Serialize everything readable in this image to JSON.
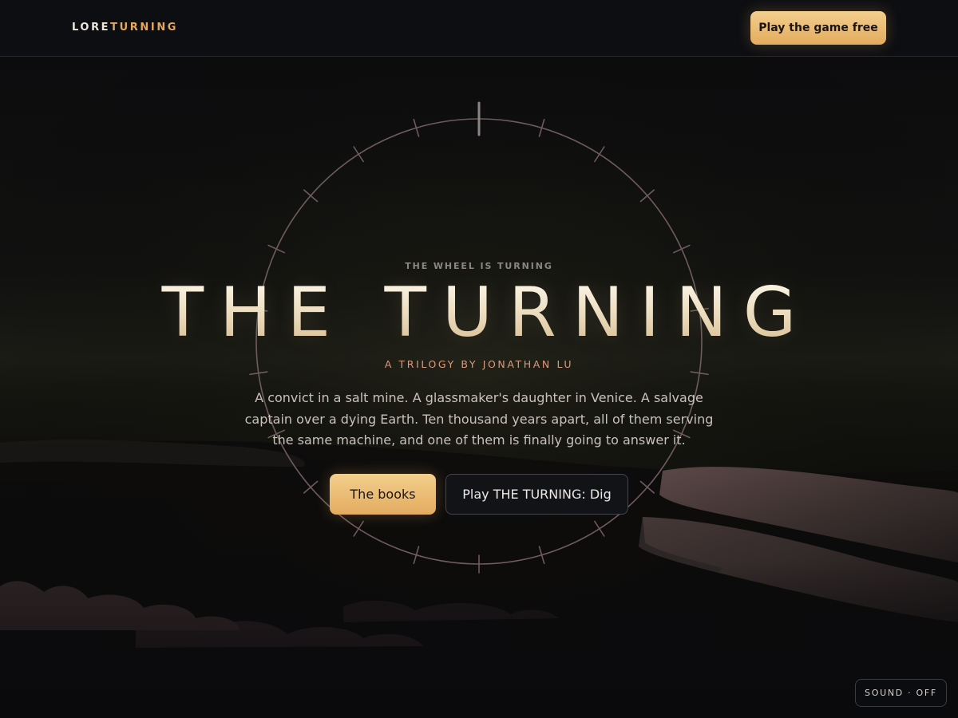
{
  "header": {
    "brand_part1": "LORE",
    "brand_part2": "TURNING",
    "cta_label": "Play the game free"
  },
  "hero": {
    "eyebrow": "THE WHEEL IS TURNING",
    "title": "THE TURNING",
    "byline": "A TRILOGY BY JONATHAN LU",
    "blurb": "A convict in a salt mine. A glassmaker's daughter in Venice. A salvage captain over a dying Earth. Ten thousand years apart, all of them serving the same machine, and one of them is finally going to answer it.",
    "primary_button": "The books",
    "secondary_button": "Play THE TURNING: Dig"
  },
  "sound_toggle": {
    "label": "SOUND · OFF"
  },
  "colors": {
    "background": "#0a0a0d",
    "accent_gold": "#e6a85a",
    "byline_rose": "#d99a80",
    "wheel_stroke": "#6e5b5e"
  },
  "icons": [
    "wheel-dial-icon"
  ]
}
